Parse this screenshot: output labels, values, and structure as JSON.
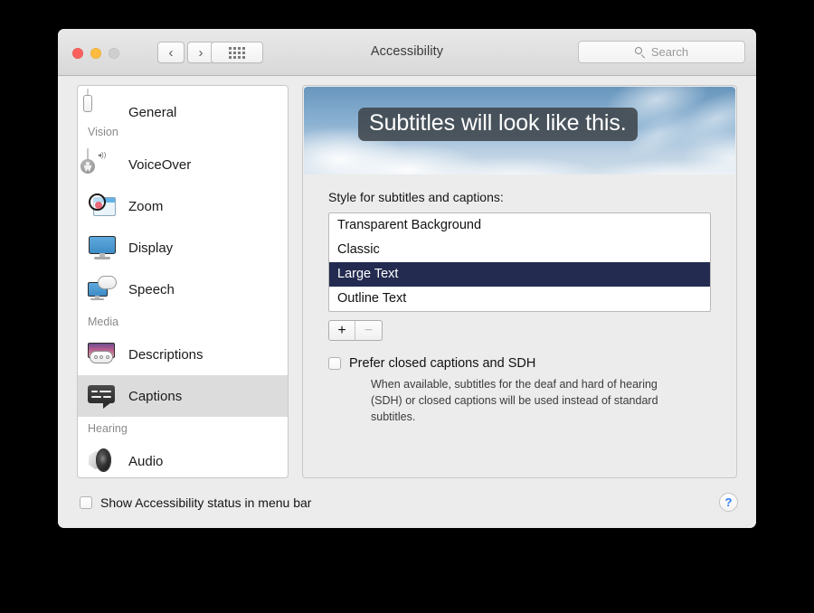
{
  "window": {
    "title": "Accessibility"
  },
  "toolbar": {
    "back_icon": "‹",
    "forward_icon": "›",
    "grid_icon": "grid-view-icon",
    "search": {
      "placeholder": "Search",
      "value": ""
    }
  },
  "sidebar": {
    "rows": [
      {
        "type": "item",
        "label": "General",
        "icon": "general-icon",
        "selected": false
      },
      {
        "type": "header",
        "label": "Vision"
      },
      {
        "type": "item",
        "label": "VoiceOver",
        "icon": "voiceover-icon",
        "selected": false
      },
      {
        "type": "item",
        "label": "Zoom",
        "icon": "zoom-icon",
        "selected": false
      },
      {
        "type": "item",
        "label": "Display",
        "icon": "display-icon",
        "selected": false
      },
      {
        "type": "item",
        "label": "Speech",
        "icon": "speech-icon",
        "selected": false
      },
      {
        "type": "header",
        "label": "Media"
      },
      {
        "type": "item",
        "label": "Descriptions",
        "icon": "descriptions-icon",
        "selected": false
      },
      {
        "type": "item",
        "label": "Captions",
        "icon": "captions-icon",
        "selected": true
      },
      {
        "type": "header",
        "label": "Hearing"
      },
      {
        "type": "item",
        "label": "Audio",
        "icon": "audio-icon",
        "selected": false
      }
    ]
  },
  "detail": {
    "preview": {
      "subtitle_text": "Subtitles will look like this.",
      "background": "sky-with-clouds"
    },
    "style_label": "Style for subtitles and captions:",
    "styles": [
      {
        "label": "Transparent Background",
        "selected": false
      },
      {
        "label": "Classic",
        "selected": false
      },
      {
        "label": "Large Text",
        "selected": true
      },
      {
        "label": "Outline Text",
        "selected": false
      }
    ],
    "add_label": "+",
    "remove_label": "−",
    "sdh": {
      "label": "Prefer closed captions and SDH",
      "checked": false,
      "description": "When available, subtitles for the deaf and hard of hearing (SDH) or closed captions will be used instead of standard subtitles."
    }
  },
  "footer": {
    "status_label": "Show Accessibility status in menu bar",
    "status_checked": false,
    "help_label": "?"
  },
  "colors": {
    "selection_navy": "#232b50",
    "sidebar_selected": "#dcdcdc",
    "help_blue": "#2f7df6",
    "close_red": "#fc615d",
    "min_yellow": "#fdbc40",
    "zoom_gray": "#cecece"
  }
}
